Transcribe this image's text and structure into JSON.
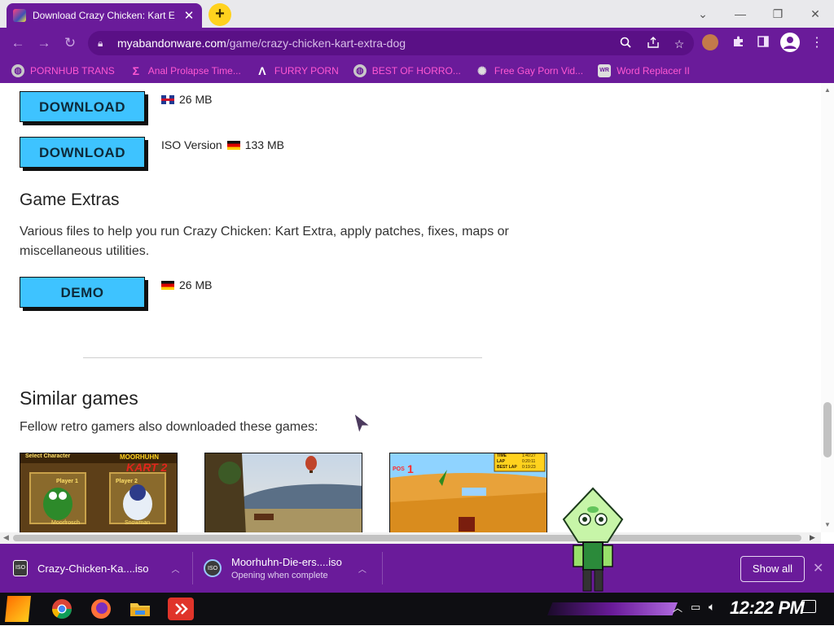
{
  "tab": {
    "title": "Download Crazy Chicken: Kart E",
    "close": "✕"
  },
  "window_controls": {
    "minimize": "—",
    "maximize": "❐",
    "close": "✕",
    "dropdown": "⌄"
  },
  "address": {
    "host": "myabandonware.com",
    "path": "/game/crazy-chicken-kart-extra-dog"
  },
  "bookmarks": [
    {
      "label": "PORNHUB TRANS"
    },
    {
      "label": "Anal Prolapse Time..."
    },
    {
      "label": "FURRY PORN"
    },
    {
      "label": "BEST OF HORRO..."
    },
    {
      "label": "Free Gay Porn Vid..."
    },
    {
      "label": "Word Replacer II"
    }
  ],
  "downloads": [
    {
      "button": "DOWNLOAD",
      "info": "26 MB"
    },
    {
      "button": "DOWNLOAD",
      "info": "ISO Version",
      "size": "133 MB"
    }
  ],
  "extras": {
    "heading": "Game Extras",
    "text": "Various files to help you run Crazy Chicken: Kart Extra, apply patches, fixes, maps or miscellaneous utilities.",
    "button": "DEMO",
    "size": "26 MB"
  },
  "similar": {
    "heading": "Similar games",
    "text": "Fellow retro gamers also downloaded these games:"
  },
  "thumb1": {
    "top_left": "Select Character",
    "logo": "MOORHUHN",
    "kart": "KART 2",
    "p1": "Player 1",
    "p2": "Player 2",
    "n1": "Moorfrosch",
    "n2": "Snowman"
  },
  "thumb3": {
    "pos": "POS",
    "pos_val": "1",
    "time_l": "TIME",
    "time_v": "1:40:27",
    "lap_l": "LAP",
    "lap_v": "0:20:11",
    "best_l": "BEST LAP",
    "best_v": "0:19:23"
  },
  "shelf": {
    "items": [
      {
        "name": "Crazy-Chicken-Ka....iso",
        "sub": ""
      },
      {
        "name": "Moorhuhn-Die-ers....iso",
        "sub": "Opening when complete"
      }
    ],
    "show_all": "Show all"
  },
  "taskbar": {
    "clock": "12:22 PM"
  },
  "colors": {
    "chrome": "#6a1b9a",
    "bookmark_text": "#ff58d2",
    "button": "#3ec3ff"
  }
}
